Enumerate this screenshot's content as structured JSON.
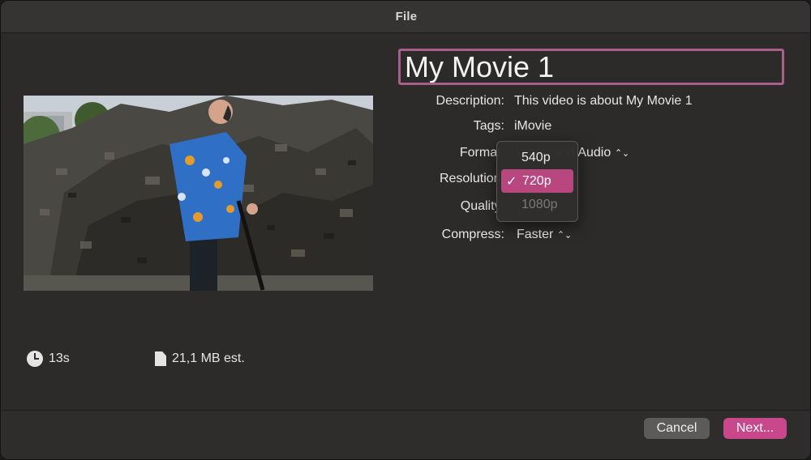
{
  "window": {
    "title": "File"
  },
  "project": {
    "title": "My Movie 1"
  },
  "fields": {
    "description_label": "Description:",
    "description_value": "This video is about My Movie 1",
    "tags_label": "Tags:",
    "tags_value": "iMovie",
    "format_label": "Format:",
    "format_value": "Video and Audio",
    "resolution_label": "Resolution:",
    "quality_label": "Quality:",
    "compress_label": "Compress:",
    "compress_value": "Faster"
  },
  "resolution_menu": {
    "items": [
      {
        "label": "540p",
        "state": "normal"
      },
      {
        "label": "720p",
        "state": "selected",
        "check": "✓"
      },
      {
        "label": "1080p",
        "state": "disabled"
      }
    ]
  },
  "info": {
    "duration": "13s",
    "file_size": "21,1 MB est."
  },
  "buttons": {
    "cancel": "Cancel",
    "next": "Next..."
  },
  "colors": {
    "accent": "#c9488c",
    "selected_item": "#b8467f",
    "title_border": "#a85f8a",
    "background": "#2d2b2a"
  }
}
